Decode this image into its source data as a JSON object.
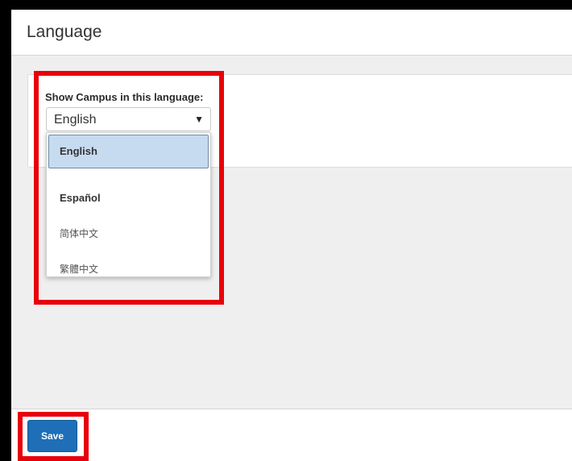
{
  "page": {
    "title": "Language"
  },
  "language_setting": {
    "label": "Show Campus in this language:",
    "selected_value": "English",
    "arrow_icon": "triangle-down-icon",
    "options": [
      {
        "label": "English",
        "selected": true
      },
      {
        "label": "Español",
        "selected": false
      },
      {
        "label": "简体中文",
        "selected": false
      },
      {
        "label": "繁體中文",
        "selected": false
      }
    ]
  },
  "footer": {
    "save_label": "Save"
  },
  "colors": {
    "highlight": "#e8000a",
    "save_button": "#1e6fb7",
    "selected_option": "#c6dbef"
  }
}
